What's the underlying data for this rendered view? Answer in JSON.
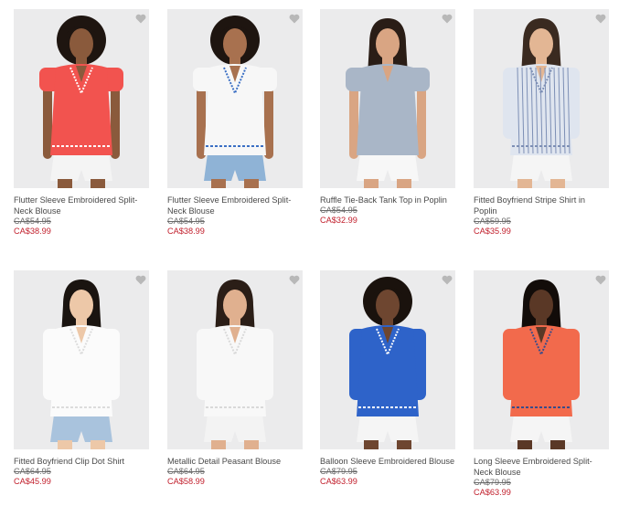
{
  "products": [
    {
      "name": "Flutter Sleeve Embroidered Split-Neck Blouse",
      "original_price": "CA$54.95",
      "sale_price": "CA$38.99",
      "icon": "heart-icon",
      "shirt_color": "#f2534f",
      "trim_color": "#ffffff",
      "bottom_color": "#f4f4f4"
    },
    {
      "name": "Flutter Sleeve Embroidered Split-Neck Blouse",
      "original_price": "CA$54.95",
      "sale_price": "CA$38.99",
      "icon": "heart-icon",
      "shirt_color": "#f7f7f7",
      "trim_color": "#3b6fc4",
      "bottom_color": "#8fb3d6"
    },
    {
      "name": "Ruffle Tie-Back Tank Top in Poplin",
      "original_price": "CA$54.95",
      "sale_price": "CA$32.99",
      "icon": "heart-icon",
      "shirt_color": "#a9b6c7",
      "trim_color": "#a9b6c7",
      "bottom_color": "#f7f7f7"
    },
    {
      "name": "Fitted Boyfriend Stripe Shirt in Poplin",
      "original_price": "CA$59.95",
      "sale_price": "CA$35.99",
      "icon": "heart-icon",
      "shirt_color": "#dfe5ef",
      "trim_color": "#7d8fb5",
      "bottom_color": "#f5f5f5"
    },
    {
      "name": "Fitted Boyfriend Clip Dot Shirt",
      "original_price": "CA$64.95",
      "sale_price": "CA$45.99",
      "icon": "heart-icon",
      "shirt_color": "#fbfbfb",
      "trim_color": "#dcdcdc",
      "bottom_color": "#a9c3dd"
    },
    {
      "name": "Metallic Detail Peasant Blouse",
      "original_price": "CA$64.95",
      "sale_price": "CA$58.99",
      "icon": "heart-icon",
      "shirt_color": "#f8f8f8",
      "trim_color": "#d9d9d9",
      "bottom_color": "#f3f3f3"
    },
    {
      "name": "Balloon Sleeve Embroidered Blouse",
      "original_price": "CA$79.95",
      "sale_price": "CA$63.99",
      "icon": "heart-icon",
      "shirt_color": "#2e63c9",
      "trim_color": "#ffffff",
      "bottom_color": "#f5f5f5"
    },
    {
      "name": "Long Sleeve Embroidered Split-Neck Blouse",
      "original_price": "CA$79.95",
      "sale_price": "CA$63.99",
      "icon": "heart-icon",
      "shirt_color": "#f26a4c",
      "trim_color": "#3a4c8a",
      "bottom_color": "#f5f5f5"
    }
  ]
}
